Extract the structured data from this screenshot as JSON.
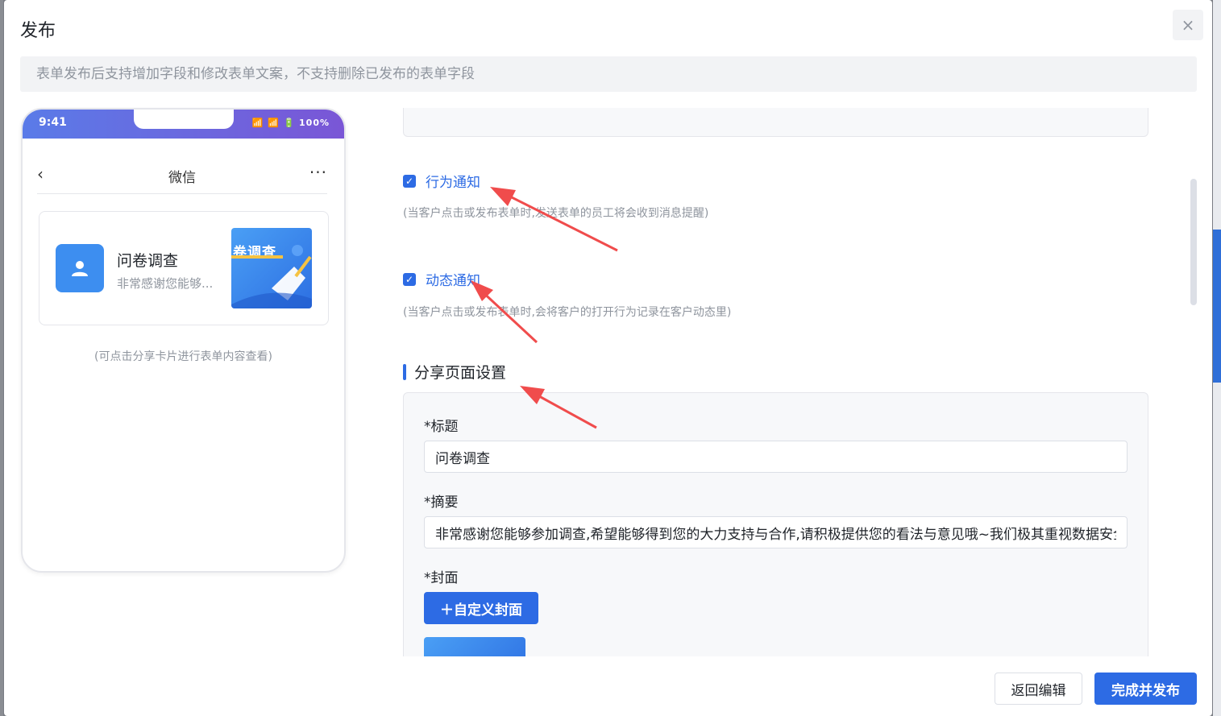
{
  "dialog": {
    "title": "发布",
    "close_label": "×",
    "notice": "表单发布后支持增加字段和修改表单文案，不支持删除已发布的表单字段"
  },
  "phone": {
    "time": "9:41",
    "indicators": "📶 📶 🔋 100%",
    "nav": {
      "back": "‹",
      "title": "微信",
      "more": "···"
    },
    "card": {
      "title": "问卷调查",
      "desc": "非常感谢您能够...",
      "thumb_text": "卷调查"
    },
    "hint": "(可点击分享卡片进行表单内容查看)"
  },
  "settings": {
    "behavior_notify": {
      "label": "行为通知",
      "checked": true,
      "hint": "(当客户点击或发布表单时,发送表单的员工将会收到消息提醒)"
    },
    "dynamic_notify": {
      "label": "动态通知",
      "checked": true,
      "hint": "(当客户点击或发布表单时,会将客户的打开行为记录在客户动态里)"
    },
    "check_mark": "✓"
  },
  "share": {
    "section_title": "分享页面设置",
    "title_label": "*标题",
    "title_value": "问卷调查",
    "summary_label": "*摘要",
    "summary_value": "非常感谢您能够参加调查,希望能够得到您的大力支持与合作,请积极提供您的看法与意见哦~我们极其重视数据安全",
    "cover_label": "*封面",
    "cover_button": "＋自定义封面"
  },
  "footer": {
    "back_label": "返回编辑",
    "publish_label": "完成并发布"
  },
  "colors": {
    "primary": "#2d6be4",
    "arrow": "#f04c4c"
  }
}
